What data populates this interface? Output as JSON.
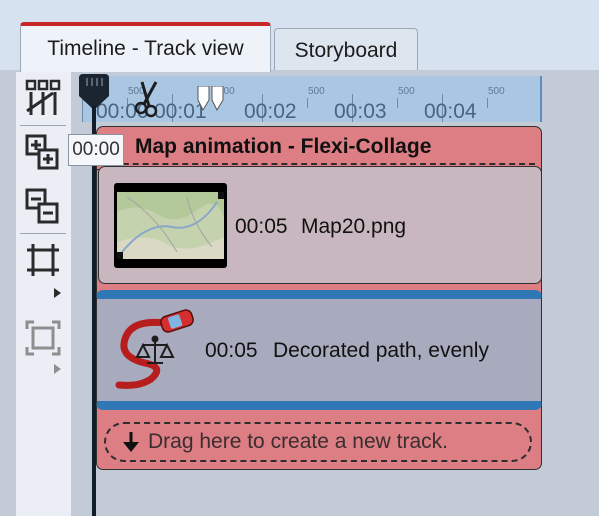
{
  "tabs": [
    {
      "label": "Timeline - Track view",
      "active": true
    },
    {
      "label": "Storyboard",
      "active": false
    }
  ],
  "toolbar": {
    "tools": [
      {
        "icon": "track-layout-icon",
        "enabled": true
      },
      {
        "icon": "add-track-icon",
        "enabled": true
      },
      {
        "icon": "remove-track-icon",
        "enabled": true
      },
      {
        "icon": "fit-tracks-icon",
        "enabled": true,
        "has_menu": true
      },
      {
        "icon": "fit-all-icon",
        "enabled": false,
        "has_menu": true
      }
    ]
  },
  "ruler": {
    "minor_label": "500",
    "times": [
      "00:00",
      "00:01",
      "00:02",
      "00:03",
      "00:04"
    ]
  },
  "tooltip": "00:00",
  "collage": {
    "title": "Map animation - Flexi-Collage",
    "clips": [
      {
        "time": "00:05",
        "name": "Map20.png"
      },
      {
        "time": "00:05",
        "name": "Decorated path, evenly"
      }
    ]
  },
  "drop_zone": {
    "label": "Drag here to create a new track."
  },
  "colors": {
    "collage": "#dc7e83",
    "clip_image": "#c9b7bf",
    "clip_animation": "#a7abbd",
    "animation_border": "#2f78b5",
    "ruler": "#a9c7e3",
    "tab_accent": "#c62828"
  }
}
